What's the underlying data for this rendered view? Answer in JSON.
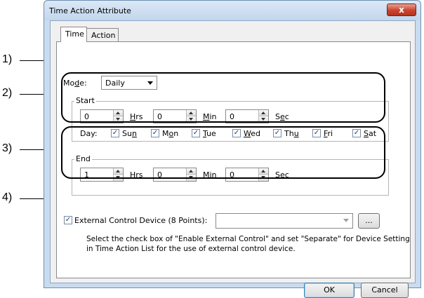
{
  "window": {
    "title": "Time Action Attribute",
    "close_glyph": "x"
  },
  "tabs": [
    {
      "label": "Time"
    },
    {
      "label": "Action"
    }
  ],
  "mode": {
    "label": "Mode:",
    "value": "Daily"
  },
  "start": {
    "label": "Start",
    "hrs": {
      "value": "0",
      "unit": "Hrs"
    },
    "min": {
      "value": "0",
      "unit": "Min"
    },
    "sec": {
      "value": "0",
      "unit": "Sec"
    },
    "day_label": "Day:",
    "days": [
      {
        "label": "Sun",
        "checked": true
      },
      {
        "label": "Mon",
        "checked": true
      },
      {
        "label": "Tue",
        "checked": true
      },
      {
        "label": "Wed",
        "checked": true
      },
      {
        "label": "Thu",
        "checked": true
      },
      {
        "label": "Fri",
        "checked": true
      },
      {
        "label": "Sat",
        "checked": true
      }
    ]
  },
  "end": {
    "label": "End",
    "hrs": {
      "value": "1",
      "unit": "Hrs"
    },
    "min": {
      "value": "0",
      "unit": "Min"
    },
    "sec": {
      "value": "0",
      "unit": "Sec"
    }
  },
  "external": {
    "label": "External Control Device (8 Points):",
    "checked": true,
    "value": "",
    "browse_label": "...",
    "note_line1": "Select the check box of \"Enable External Control\" and set \"Separate\" for Device Setting",
    "note_line2": "in Time Action List for the use of external control device."
  },
  "buttons": {
    "ok": "OK",
    "cancel": "Cancel"
  },
  "callouts": [
    "1)",
    "2)",
    "3)",
    "4)"
  ],
  "check_glyph": "✓"
}
